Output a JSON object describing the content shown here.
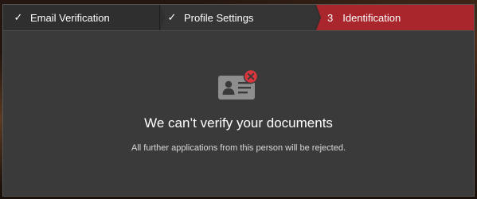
{
  "stepper": {
    "steps": [
      {
        "label": "Email Verification",
        "status": "complete",
        "icon": "check-icon"
      },
      {
        "label": "Profile Settings",
        "status": "complete",
        "icon": "check-icon"
      },
      {
        "number": "3",
        "label": "Identification",
        "status": "active"
      }
    ],
    "active_color": "#a8262c"
  },
  "message": {
    "icon": "id-card-error-icon",
    "title": "We can’t verify your documents",
    "subtitle": "All further applications from this person will be rejected."
  },
  "colors": {
    "modal_bg": "#3a3a3a",
    "stepper_bg": "#2f2f2f",
    "error_badge": "#d9363e"
  }
}
